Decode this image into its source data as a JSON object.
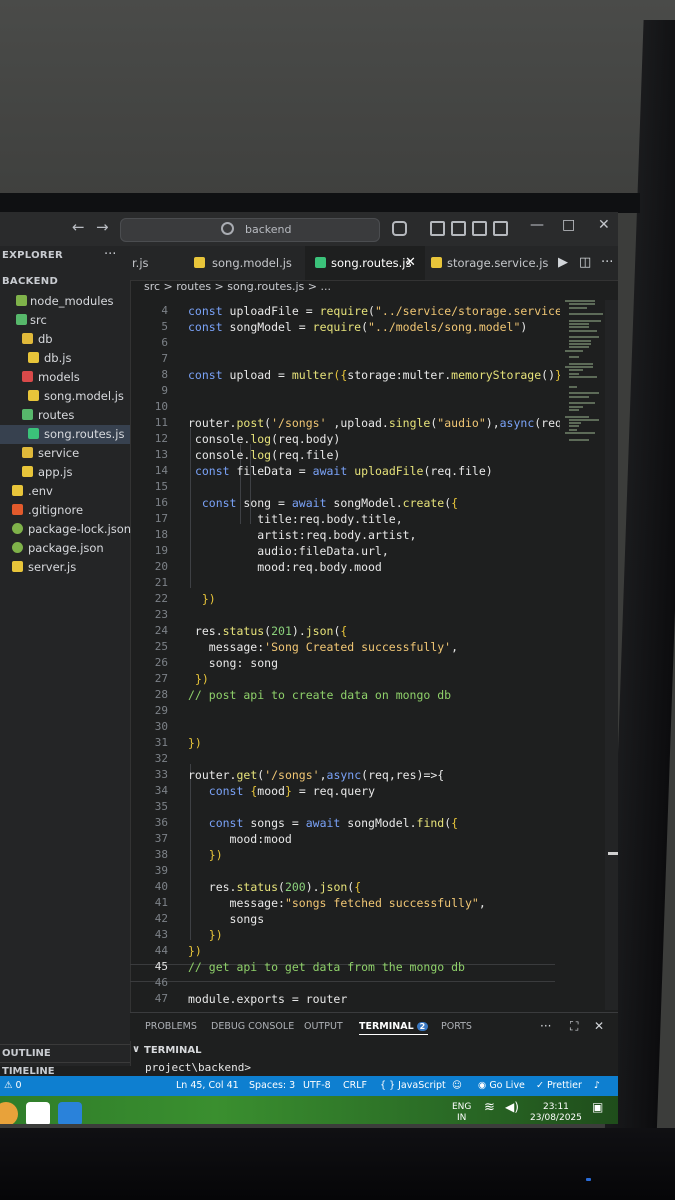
{
  "window": {
    "search_text": "backend",
    "nav_back": "←",
    "nav_forward": "→",
    "minimize": "—",
    "maximize": "□",
    "close": "✕"
  },
  "sidebar": {
    "header": "EXPLORER",
    "more": "···",
    "root": "BACKEND",
    "items": [
      {
        "label": "node_modules",
        "color": "#7fb24a"
      },
      {
        "label": "src",
        "color": "#57b86b"
      },
      {
        "label": "db",
        "color": "#e0b93a"
      },
      {
        "label": "db.js",
        "color": "#e8c53a"
      },
      {
        "label": "models",
        "color": "#d94a4a"
      },
      {
        "label": "song.model.js",
        "color": "#e8c53a"
      },
      {
        "label": "routes",
        "color": "#57b86b"
      },
      {
        "label": "song.routes.js",
        "color": "#3bc27a"
      },
      {
        "label": "service",
        "color": "#e0b93a"
      },
      {
        "label": "app.js",
        "color": "#e8c53a"
      },
      {
        "label": ".env",
        "color": "#e8c53a"
      },
      {
        "label": ".gitignore",
        "color": "#e25a2c"
      },
      {
        "label": "package-lock.json",
        "color": "#7fb24a"
      },
      {
        "label": "package.json",
        "color": "#7fb24a"
      },
      {
        "label": "server.js",
        "color": "#e8c53a"
      }
    ],
    "outline": "OUTLINE",
    "timeline": "TIMELINE"
  },
  "tabs": [
    {
      "label": "r.js"
    },
    {
      "label": "song.model.js"
    },
    {
      "label": "song.routes.js"
    },
    {
      "label": "storage.service.js"
    }
  ],
  "breadcrumb": "src > routes > song.routes.js > ...",
  "code_lines": [
    {
      "n": "4",
      "html": "<span class=\"kw\">const</span> uploadFile = <span class=\"fn\">require</span>(<span class=\"str\">\"../service/storage.service\"</span>)"
    },
    {
      "n": "5",
      "html": "<span class=\"kw\">const</span> songModel = <span class=\"fn\">require</span>(<span class=\"str\">\"../models/song.model\"</span>)"
    },
    {
      "n": "6",
      "html": ""
    },
    {
      "n": "7",
      "html": ""
    },
    {
      "n": "8",
      "html": "<span class=\"kw\">const</span> upload = <span class=\"fn\">multer</span><span class=\"br\">({</span>storage:multer.<span class=\"fn\">memoryStorage</span>()<span class=\"br\">})</span> /"
    },
    {
      "n": "9",
      "html": ""
    },
    {
      "n": "10",
      "html": ""
    },
    {
      "n": "11",
      "html": "router.<span class=\"fn\">post</span>(<span class=\"str\">'/songs'</span> ,upload.<span class=\"fn\">single</span>(<span class=\"str\">\"audio\"</span>),<span class=\"kw\">async</span>(req,re"
    },
    {
      "n": "12",
      "html": " console.<span class=\"fn\">log</span>(req.body)"
    },
    {
      "n": "13",
      "html": " console.<span class=\"fn\">log</span>(req.file)"
    },
    {
      "n": "14",
      "html": " <span class=\"kw\">const</span> fileData = <span class=\"kw\">await</span> <span class=\"fn\">uploadFile</span>(req.file)"
    },
    {
      "n": "15",
      "html": ""
    },
    {
      "n": "16",
      "html": "  <span class=\"kw\">const</span> song = <span class=\"kw\">await</span> songModel.<span class=\"fn\">create</span>(<span class=\"br\">{</span>"
    },
    {
      "n": "17",
      "html": "          title:req.body.title,"
    },
    {
      "n": "18",
      "html": "          artist:req.body.artist,"
    },
    {
      "n": "19",
      "html": "          audio:fileData.url,"
    },
    {
      "n": "20",
      "html": "          mood:req.body.mood"
    },
    {
      "n": "21",
      "html": ""
    },
    {
      "n": "22",
      "html": "  <span class=\"br\">})</span>"
    },
    {
      "n": "23",
      "html": ""
    },
    {
      "n": "24",
      "html": " res.<span class=\"fn\">status</span>(<span class=\"num\">201</span>).<span class=\"fn\">json</span>(<span class=\"br\">{</span>"
    },
    {
      "n": "25",
      "html": "   message:<span class=\"str\">'Song Created successfully'</span>,"
    },
    {
      "n": "26",
      "html": "   song: song"
    },
    {
      "n": "27",
      "html": " <span class=\"br\">})</span>"
    },
    {
      "n": "28",
      "html": "<span class=\"cm\">// post api to create data on mongo db</span>"
    },
    {
      "n": "29",
      "html": ""
    },
    {
      "n": "30",
      "html": ""
    },
    {
      "n": "31",
      "html": "<span class=\"br\">})</span>"
    },
    {
      "n": "32",
      "html": ""
    },
    {
      "n": "33",
      "html": "router.<span class=\"fn\">get</span>(<span class=\"str\">'/songs'</span>,<span class=\"kw\">async</span>(req,res)=>{"
    },
    {
      "n": "34",
      "html": "   <span class=\"kw\">const</span> <span class=\"br\">{</span>mood<span class=\"br\">}</span> = req.query"
    },
    {
      "n": "35",
      "html": ""
    },
    {
      "n": "36",
      "html": "   <span class=\"kw\">const</span> songs = <span class=\"kw\">await</span> songModel.<span class=\"fn\">find</span>(<span class=\"br\">{</span>"
    },
    {
      "n": "37",
      "html": "      mood:mood"
    },
    {
      "n": "38",
      "html": "   <span class=\"br\">})</span>"
    },
    {
      "n": "39",
      "html": ""
    },
    {
      "n": "40",
      "html": "   res.<span class=\"fn\">status</span>(<span class=\"num\">200</span>).<span class=\"fn\">json</span>(<span class=\"br\">{</span>"
    },
    {
      "n": "41",
      "html": "      message:<span class=\"str\">\"songs fetched successfully\"</span>,"
    },
    {
      "n": "42",
      "html": "      songs"
    },
    {
      "n": "43",
      "html": "   <span class=\"br\">})</span>"
    },
    {
      "n": "44",
      "html": "<span class=\"br\">})</span>"
    },
    {
      "n": "45",
      "html": "<span class=\"cm\">// get api to get data from the mongo db</span>"
    },
    {
      "n": "46",
      "html": ""
    },
    {
      "n": "47",
      "html": "module.exports = router"
    }
  ],
  "panel": {
    "tabs": [
      "PROBLEMS",
      "DEBUG CONSOLE",
      "OUTPUT",
      "TERMINAL",
      "PORTS"
    ],
    "terminal_badge": "2",
    "terminal_header": "TERMINAL",
    "prompt": "project\\backend>"
  },
  "status": {
    "problems": "⚠ 0",
    "position": "Ln 45, Col 41",
    "spaces": "Spaces: 3",
    "encoding": "UTF-8",
    "eol": "CRLF",
    "language": "{ } JavaScript",
    "golive": "Go Live",
    "prettier": "✓ Prettier"
  },
  "taskbar": {
    "lang": "ENG",
    "region": "IN",
    "time": "23:11",
    "date": "23/08/2025"
  }
}
